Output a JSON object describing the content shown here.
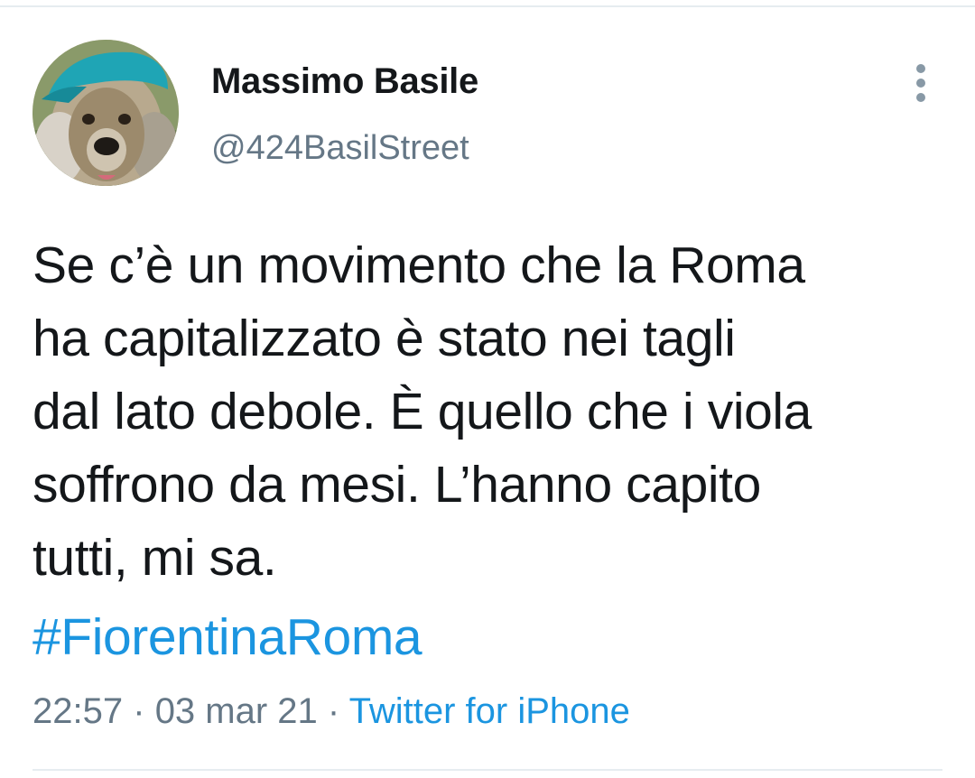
{
  "author": {
    "display_name": "Massimo Basile",
    "handle": "@424BasilStreet"
  },
  "tweet": {
    "lines": [
      "Se c’è un movimento che la Roma",
      "ha capitalizzato è stato nei tagli",
      "dal lato debole. È quello che i viola",
      "soffrono da mesi. L’hanno capito",
      "tutti, mi sa."
    ],
    "hashtag": "#FiorentinaRoma"
  },
  "meta": {
    "time": "22:57",
    "separator": "·",
    "date": "03 mar 21",
    "source": "Twitter for iPhone"
  },
  "icons": {
    "more": "more-vertical-icon"
  },
  "colors": {
    "text": "#14171a",
    "secondary": "#657786",
    "link": "#1b95e0",
    "divider": "#e6ecf0"
  }
}
